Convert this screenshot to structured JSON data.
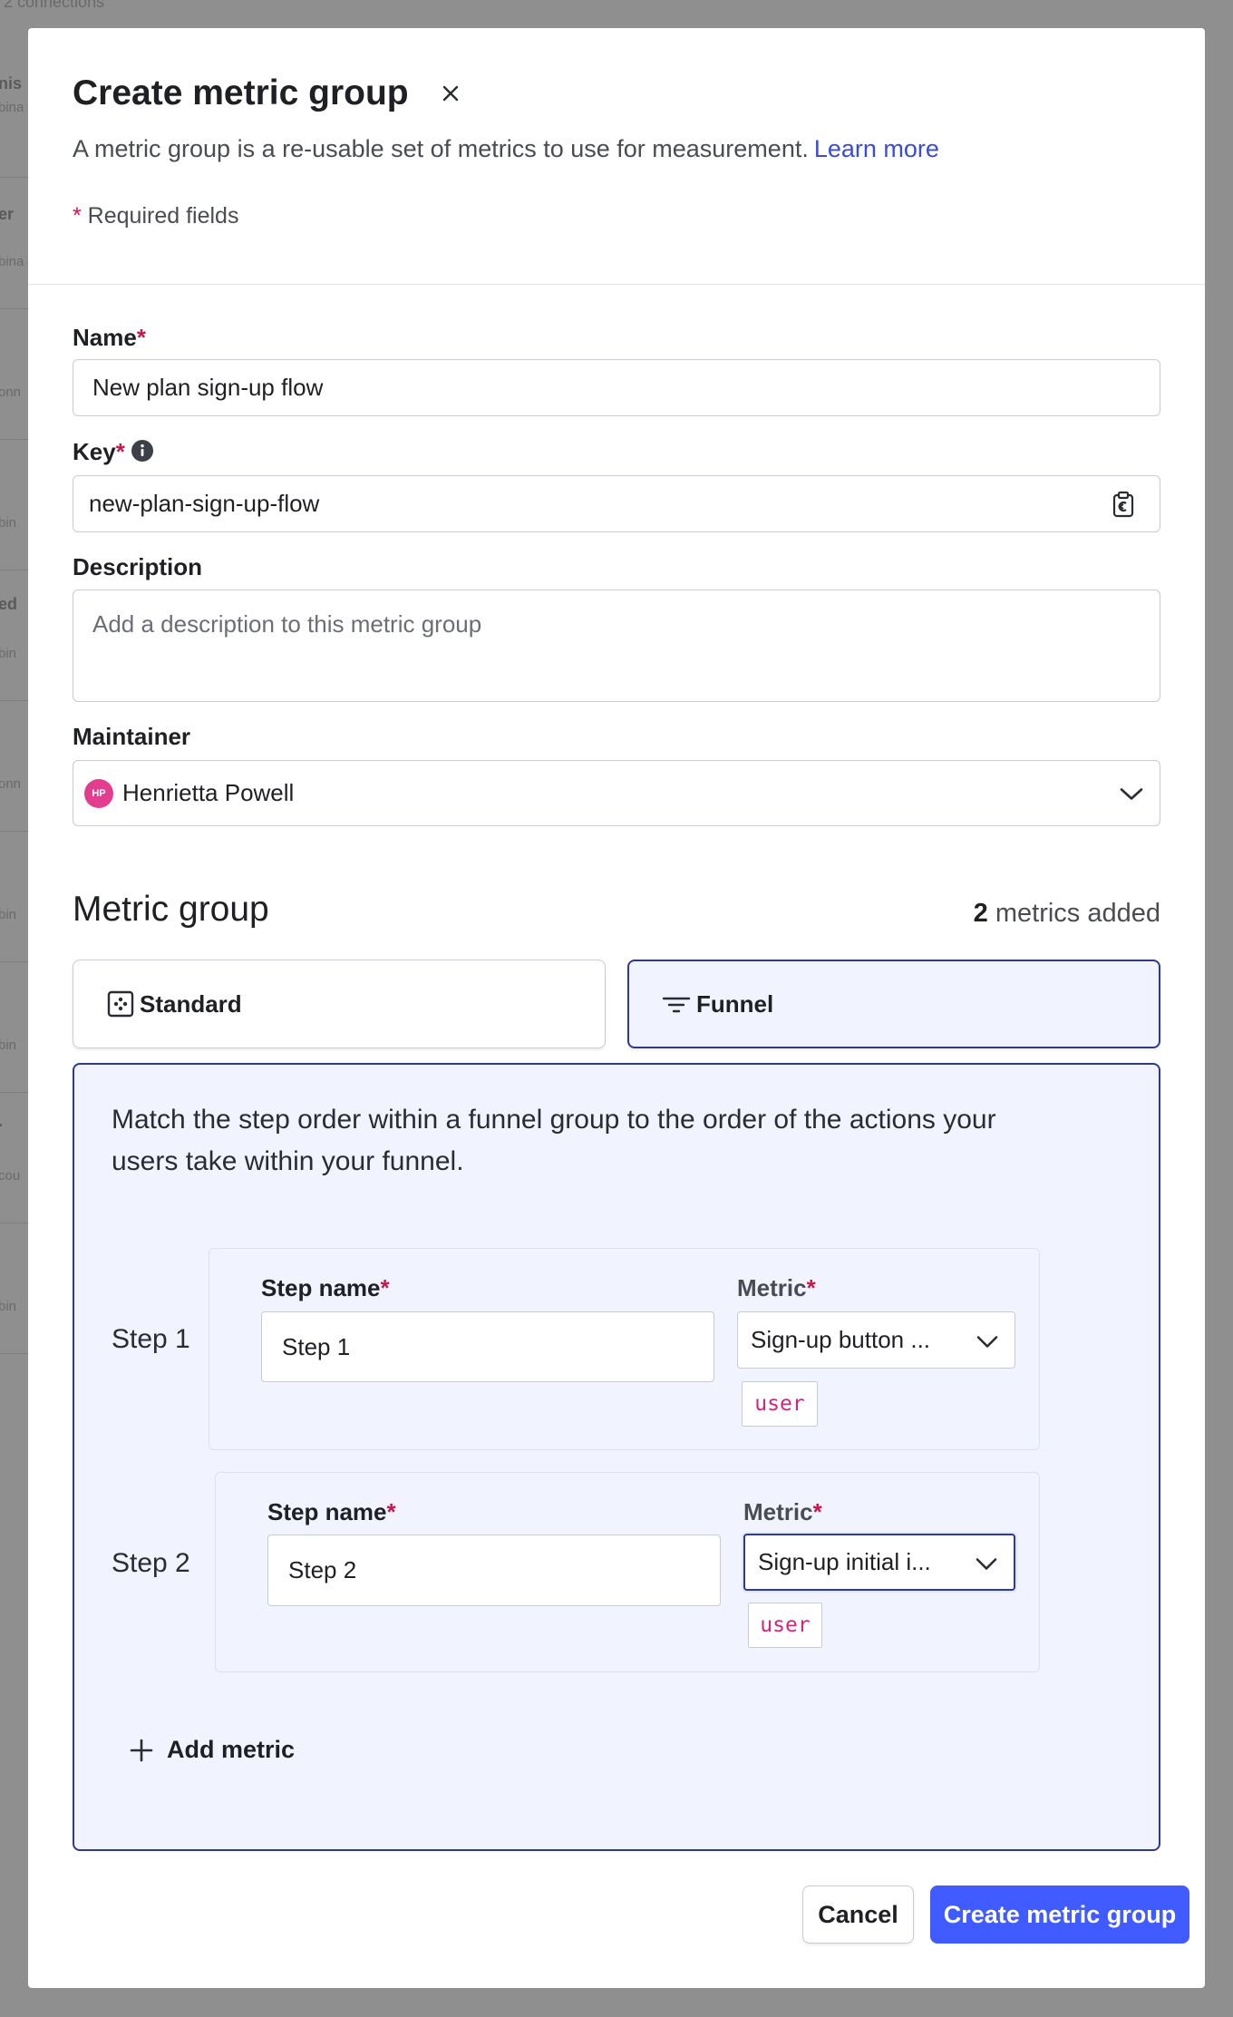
{
  "background_fragments": [
    {
      "text": "2 connections"
    },
    {
      "text": "nis"
    },
    {
      "text": "bina"
    },
    {
      "text": "er"
    },
    {
      "text": "bina"
    },
    {
      "text": "onn"
    },
    {
      "text": "bin"
    },
    {
      "text": "ed"
    },
    {
      "text": "bin"
    },
    {
      "text": "onn"
    },
    {
      "text": "bin"
    },
    {
      "text": "bin"
    },
    {
      "text": "."
    },
    {
      "text": "cou"
    },
    {
      "text": "bin"
    }
  ],
  "modal": {
    "title": "Create metric group",
    "subtitle": "A metric group is a re-usable set of metrics to use for measurement.",
    "learn_more": "Learn more",
    "required_asterisk": "*",
    "required_note": " Required fields"
  },
  "form": {
    "name_label": "Name",
    "name_value": "New plan sign-up flow",
    "key_label": "Key",
    "key_value": "new-plan-sign-up-flow",
    "description_label": "Description",
    "description_placeholder": "Add a description to this metric group",
    "maintainer_label": "Maintainer",
    "maintainer_initials": "HP",
    "maintainer_name": "Henrietta Powell",
    "asterisk": "*"
  },
  "metric_group": {
    "title": "Metric group",
    "count": "2",
    "count_suffix": " metrics added",
    "type_standard": "Standard",
    "type_funnel": "Funnel",
    "selected_type": "Funnel",
    "funnel_description": "Match the step order within a funnel group to the order of the actions your users take within your funnel.",
    "step_name_label": "Step name",
    "metric_label": "Metric",
    "steps": [
      {
        "label": "Step 1",
        "name": "Step 1",
        "metric": "Sign-up button ...",
        "context": "user"
      },
      {
        "label": "Step 2",
        "name": "Step 2",
        "metric": "Sign-up initial i...",
        "context": "user"
      }
    ],
    "add_metric": "Add metric"
  },
  "footer": {
    "cancel": "Cancel",
    "submit": "Create metric group"
  },
  "colors": {
    "primary": "#405bff",
    "accent_border": "#2e3a8c",
    "panel_bg": "#f1f4ff",
    "required": "#c8174a",
    "tag_text": "#d6247a",
    "avatar": "#e23d8f",
    "overlay": "#8f8f8f"
  },
  "icons": [
    "close-icon",
    "info-icon",
    "copy-icon",
    "chevron-down-icon",
    "standard-icon",
    "funnel-icon",
    "drag-handle-icon",
    "plus-icon"
  ]
}
